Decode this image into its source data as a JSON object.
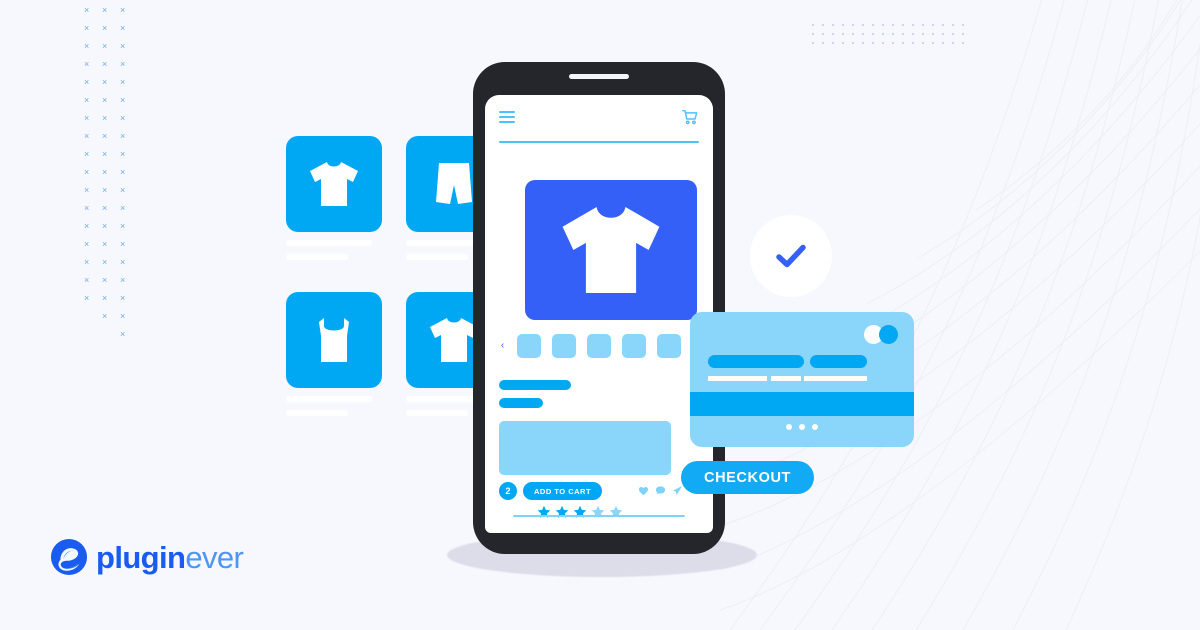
{
  "brand": {
    "logo_primary": "plugin",
    "logo_secondary": "ever",
    "logo_mark_name": "pluginever-e-mark",
    "color_primary": "#1a5cf0",
    "color_secondary": "#4e95f5"
  },
  "palette": {
    "background": "#f6f8fd",
    "accent_blue": "#00a8f3",
    "light_blue": "#8ad6fb",
    "royal_blue": "#3560f7",
    "checkout_blue": "#13aaf5",
    "phone_body": "#24262b",
    "white": "#ffffff"
  },
  "phone": {
    "topbar": {
      "menu_icon": "hamburger-menu-icon",
      "cart_icon": "shopping-cart-icon"
    },
    "hero": {
      "product_icon": "tshirt-icon",
      "background_color": "#3560f7"
    },
    "carousel": {
      "prev_label": "‹",
      "next_label": "›",
      "thumbnails": [
        "thumb-1",
        "thumb-2",
        "thumb-3",
        "thumb-4",
        "thumb-5"
      ]
    },
    "product": {
      "title_placeholder": "",
      "subtitle_placeholder": "",
      "description_placeholder": ""
    },
    "actions": {
      "quantity": "2",
      "add_to_cart_label": "ADD TO CART",
      "social": [
        "heart-icon",
        "comment-icon",
        "share-icon"
      ]
    },
    "rating": {
      "value": 3,
      "max": 5,
      "filled_color": "#00a8f3",
      "empty_color": "#8ad6fb"
    }
  },
  "product_grid": {
    "items": [
      {
        "icon": "tshirt-icon",
        "name": "product-tile-tshirt"
      },
      {
        "icon": "shorts-icon",
        "name": "product-tile-shorts"
      },
      {
        "icon": "tank-top-icon",
        "name": "product-tile-tank-top"
      },
      {
        "icon": "tshirt-icon",
        "name": "product-tile-tshirt-2"
      }
    ]
  },
  "credit_card": {
    "logo_icon": "card-network-logo",
    "number_dashes": 3,
    "chip_dots": 3
  },
  "checkout": {
    "button_label": "CHECKOUT"
  },
  "success": {
    "icon": "checkmark-icon",
    "color": "#3560f7"
  },
  "decorations": {
    "x_pattern_glyph": "×",
    "x_pattern_color": "#6aa8f7",
    "dot_pattern_color": "#b9cdf2",
    "mesh_color": "#e9e6ee"
  }
}
